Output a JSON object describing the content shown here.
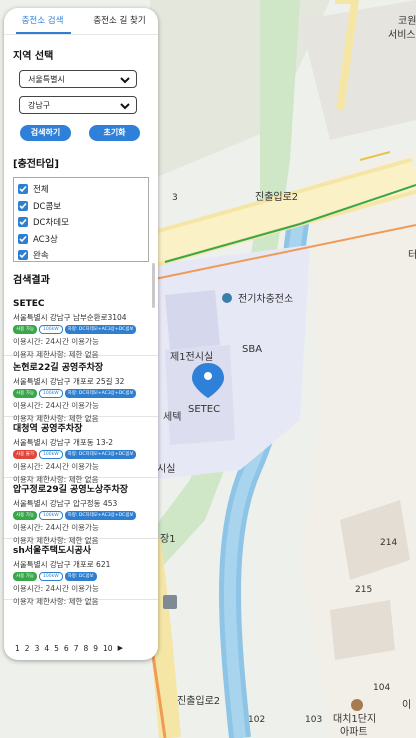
{
  "tabs": [
    "충전소 검색",
    "충전소 길 찾기"
  ],
  "region": {
    "title": "지역 선택",
    "city": "서울특별시",
    "district": "강남구",
    "search_label": "검색하기",
    "reset_label": "초기화"
  },
  "charger_type": {
    "title": "[충전타입]",
    "options": [
      "전체",
      "DC콤보",
      "DC차데모",
      "AC3상",
      "완속"
    ]
  },
  "results_title": "검색결과",
  "results": [
    {
      "name": "SETEC",
      "address": "서울특별시 강남구 남부순환로3104",
      "status": "사용 가능",
      "status_ok": true,
      "speed": "100kW",
      "types": "차량: DC차데모+AC3상+DC콤보",
      "hours": "이용시간: 24시간 이용가능",
      "limit": "이용자 제한사항: 제한 없음"
    },
    {
      "name": "논현로22길 공영주차장",
      "address": "서울특별시 강남구 개포로 25길 32",
      "status": "사용 가능",
      "status_ok": true,
      "speed": "100kW",
      "types": "차량: DC차데모+AC3상+DC콤보",
      "hours": "이용시간: 24시간 이용가능",
      "limit": "이용자 제한사항: 제한 없음"
    },
    {
      "name": "대청역 공영주차장",
      "address": "서울특별시 강남구 개포동 13-2",
      "status": "사용 불가",
      "status_ok": false,
      "speed": "100kW",
      "types": "차량: DC차데모+AC3상+DC콤보",
      "hours": "이용시간: 24시간 이용가능",
      "limit": "이용자 제한사항: 제한 없음"
    },
    {
      "name": "압구정로29길 공영노상주차장",
      "address": "서울특별시 강남구 압구정동 453",
      "status": "사용 가능",
      "status_ok": true,
      "speed": "100kW",
      "types": "차량: DC차데모+AC3상+DC콤보",
      "hours": "이용시간: 24시간 이용가능",
      "limit": "이용자 제한사항: 제한 없음"
    },
    {
      "name": "sh서울주택도시공사",
      "address": "서울특별시 강남구 개포로 621",
      "status": "사용 가능",
      "status_ok": true,
      "speed": "100kW",
      "types": "차량: DC콤보",
      "hours": "이용시간: 24시간 이용가능",
      "limit": "이용자 제한사항: 제한 없음"
    }
  ],
  "pager": {
    "pages": [
      "1",
      "2",
      "3",
      "4",
      "5",
      "6",
      "7",
      "8",
      "9",
      "10"
    ],
    "next": "▶"
  },
  "map_labels": {
    "apt1": "코원에너",
    "apt2": "서비스",
    "road1": "진출입로2",
    "road2": "진출입로2",
    "station": "전기차충전소",
    "sba": "SBA",
    "building1": "제1전시실",
    "setec": "SETEC",
    "exhibit": "세텍",
    "exhibit2": "시실",
    "parking": "장1",
    "n3": "3",
    "n214": "214",
    "n215": "215",
    "n102": "102",
    "n103": "103",
    "n104": "104",
    "apt3": "대치1단지",
    "apt4": "아파트",
    "t1": "터",
    "t2": "이"
  },
  "colors": {
    "accent": "#2f7fd1",
    "ok": "#3aa64a",
    "no": "#e0443a"
  }
}
